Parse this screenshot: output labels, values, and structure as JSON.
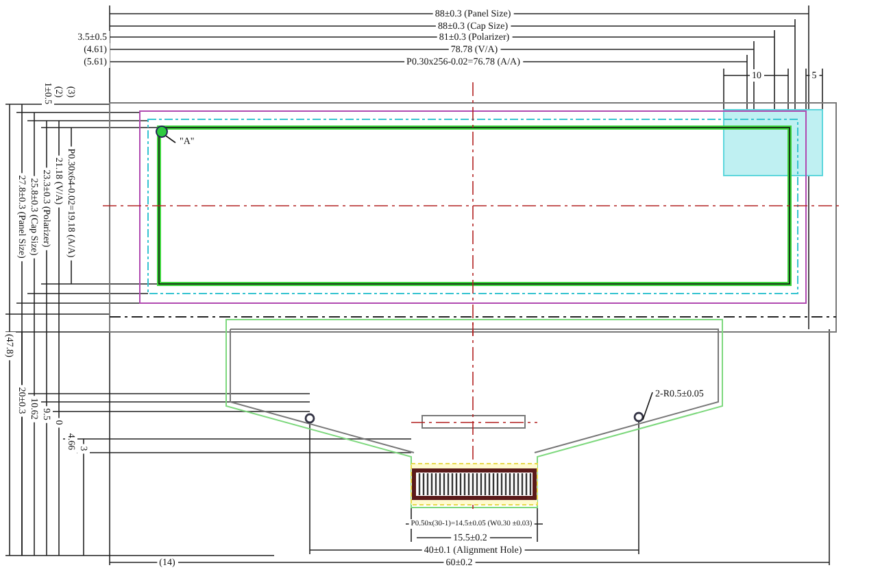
{
  "top_dimensions": [
    "88±0.3 (Panel Size)",
    "88±0.3 (Cap Size)",
    "81±0.3 (Polarizer)",
    "78.78 (V/A)",
    "P0.30x256-0.02=76.78 (A/A)"
  ],
  "left_offsets": [
    "3.5±0.5",
    "(4.61)",
    "(5.61)"
  ],
  "corner_dimensions": [
    "10",
    "5"
  ],
  "side_offsets": [
    "1±0.5",
    "(2)",
    "(3)"
  ],
  "vertical_dimensions": [
    "P0.30x64-0.02=19.18 (A/A)",
    "21.18 (V/A)",
    "23.3±0.3 (Polarizer)",
    "25.8±0.3 (Cap Size)",
    "27.8±0.3 (Panel Size)",
    "(47.8)"
  ],
  "fpc_vertical_dimensions": [
    "20±0.3",
    "10.62",
    "9.5",
    "0",
    "4.66",
    "3"
  ],
  "callouts": [
    "\"A\"",
    "2-R0.5±0.05"
  ],
  "bottom_dimensions": [
    "P0.50x(30-1)=14.5±0.05 (W0.30 ±0.03)",
    "15.5±0.2",
    "40±0.1 (Alignment Hole)",
    "60±0.2",
    "(14)"
  ]
}
